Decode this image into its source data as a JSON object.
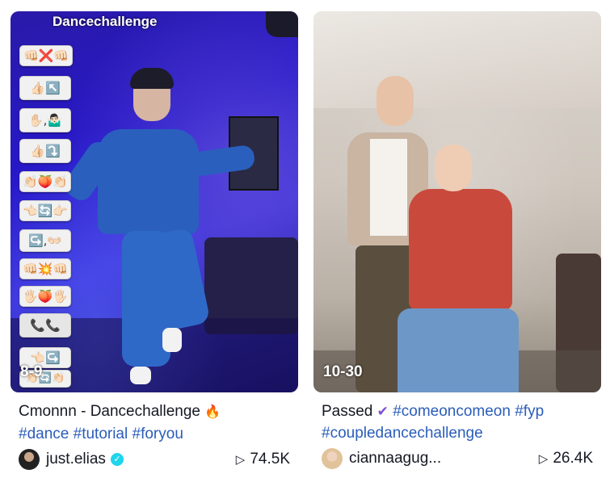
{
  "videos": [
    {
      "overlay_title": "Dancechallenge",
      "stickers": [
        "👊🏻❌👊🏻",
        "👍🏻↖️",
        "✋🏻,🤷🏻‍♂️",
        "👍🏻⤵️",
        "👏🏻🍑👏🏻",
        "👈🏻🔄👉🏻",
        "↪️,👐🏻",
        "👊🏻💥👊🏻",
        "🖐🏻🍑🖐🏻",
        "📞📞",
        "👈🏻↪️",
        "👏🏻🔄👏🏻"
      ],
      "overlay_count": "8-9",
      "caption_text": "Cmonnn - Dancechallenge",
      "caption_emoji": "🔥",
      "hashtags": [
        "#dance",
        "#tutorial",
        "#foryou"
      ],
      "author": "just.elias",
      "verified": true,
      "views": "74.5K"
    },
    {
      "overlay_count": "10-30",
      "caption_text": "Passed",
      "caption_emoji": "✔",
      "hashtags": [
        "#comeoncomeon",
        "#fyp",
        "#coupledancechallenge"
      ],
      "author": "ciannaagug...",
      "verified": false,
      "views": "26.4K"
    }
  ],
  "icons": {
    "play": "play-icon",
    "verified": "verified-badge-icon",
    "fire": "fire-emoji-icon",
    "check": "purple-check-icon"
  },
  "colors": {
    "hashtag": "#2b5db9",
    "text": "#161823",
    "verified": "#20d5ec"
  }
}
